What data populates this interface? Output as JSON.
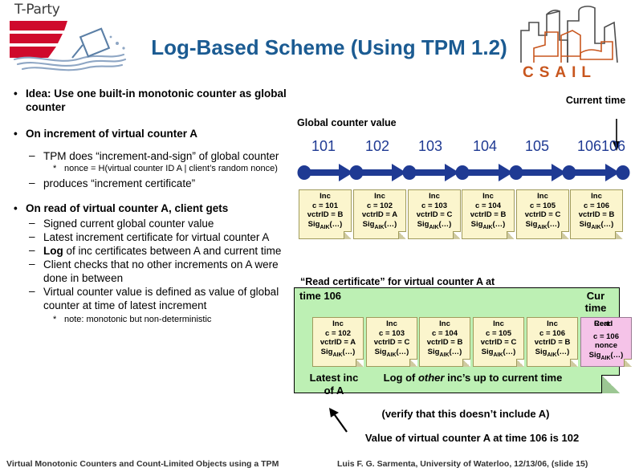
{
  "logo": {
    "tparty_label": "T-Party",
    "csail_label": "CSAIL"
  },
  "title": "Log-Based Scheme (Using TPM 1.2)",
  "bullets": [
    {
      "level": 1,
      "marker": "•",
      "text": "Idea: Use one built-in monotonic counter as global counter"
    },
    {
      "level": 1,
      "marker": "•",
      "text": "On increment of virtual counter A"
    },
    {
      "level": 2,
      "marker": "–",
      "text": "TPM does “increment-and-sign” of global counter"
    },
    {
      "level": 3,
      "marker": "*",
      "text": "nonce = H(virtual counter ID A | client’s random nonce)"
    },
    {
      "level": 2,
      "marker": "–",
      "text": "produces “increment certificate”"
    },
    {
      "level": 1,
      "marker": "•",
      "text": "On read of virtual counter A, client gets"
    },
    {
      "level": 2,
      "marker": "–",
      "text": "Signed current global counter value"
    },
    {
      "level": 2,
      "marker": "–",
      "text": "Latest increment certificate for virtual counter A"
    },
    {
      "level": 2,
      "marker": "–",
      "text": "Log of inc certificates between A and current time",
      "bold_prefix": "Log"
    },
    {
      "level": 2,
      "marker": "–",
      "text": "Client checks that no other increments on A were done in between"
    },
    {
      "level": 2,
      "marker": "–",
      "text": "Virtual counter value is defined as value of global counter at time of latest increment"
    },
    {
      "level": 3,
      "marker": "*",
      "text": "note: monotonic but non-deterministic"
    }
  ],
  "timeline": {
    "axis_label": "Global counter value",
    "current_time_label": "Current time",
    "tick_values": [
      "101",
      "102",
      "103",
      "104",
      "105",
      "106"
    ],
    "overlap_tick": "106",
    "color_dark_blue": "#1f3a93",
    "cards": [
      {
        "title": "Inc",
        "c": "c = 101",
        "vctrid": "vctrID = B",
        "sig": "Sig",
        "sig_sub": "AIK",
        "sig_tail": "(…)"
      },
      {
        "title": "Inc",
        "c": "c = 102",
        "vctrid": "vctrID = A",
        "sig": "Sig",
        "sig_sub": "AIK",
        "sig_tail": "(…)"
      },
      {
        "title": "Inc",
        "c": "c = 103",
        "vctrid": "vctrID = C",
        "sig": "Sig",
        "sig_sub": "AIK",
        "sig_tail": "(…)"
      },
      {
        "title": "Inc",
        "c": "c = 104",
        "vctrid": "vctrID = B",
        "sig": "Sig",
        "sig_sub": "AIK",
        "sig_tail": "(…)"
      },
      {
        "title": "Inc",
        "c": "c = 105",
        "vctrid": "vctrID = C",
        "sig": "Sig",
        "sig_sub": "AIK",
        "sig_tail": "(…)"
      },
      {
        "title": "Inc",
        "c": "c = 106",
        "vctrid": "vctrID = B",
        "sig": "Sig",
        "sig_sub": "AIK",
        "sig_tail": "(…)"
      }
    ]
  },
  "readcert": {
    "heading": "“Read certificate” for virtual counter A at",
    "time_label": "time 106",
    "cur_time_label": "Cur time",
    "box_color": "#bdf0b4",
    "cards": [
      {
        "title": "Inc",
        "c": "c = 102",
        "vctrid": "vctrID = A",
        "sig": "Sig",
        "sig_sub": "AIK",
        "sig_tail": "(…)",
        "pink": false
      },
      {
        "title": "Inc",
        "c": "c = 103",
        "vctrid": "vctrID = C",
        "sig": "Sig",
        "sig_sub": "AIK",
        "sig_tail": "(…)",
        "pink": false
      },
      {
        "title": "Inc",
        "c": "c = 104",
        "vctrid": "vctrID = B",
        "sig": "Sig",
        "sig_sub": "AIK",
        "sig_tail": "(…)",
        "pink": false
      },
      {
        "title": "Inc",
        "c": "c = 105",
        "vctrid": "vctrID = C",
        "sig": "Sig",
        "sig_sub": "AIK",
        "sig_tail": "(…)",
        "pink": false
      },
      {
        "title": "Inc",
        "c": "c = 106",
        "vctrid": "vctrID = B",
        "sig": "Sig",
        "sig_sub": "AIK",
        "sig_tail": "(…)",
        "pink": false
      },
      {
        "title": "Read",
        "title_overlap": "Cert",
        "c": "c = 106",
        "vctrid": "nonce",
        "sig": "Sig",
        "sig_sub": "AIK",
        "sig_tail": "(…)",
        "pink": true
      }
    ],
    "caption_latest": "Latest inc of A",
    "caption_log": "Log of other inc’s up to current time",
    "caption_log_italic": "other"
  },
  "captions": {
    "verify": "(verify that this doesn’t include A)",
    "value": "Value of virtual counter A at time 106 is 102"
  },
  "footer": {
    "left": "Virtual Monotonic Counters and Count-Limited Objects using a TPM",
    "right": "Luis F. G. Sarmenta, University of Waterloo, 12/13/06, (slide 15)"
  }
}
